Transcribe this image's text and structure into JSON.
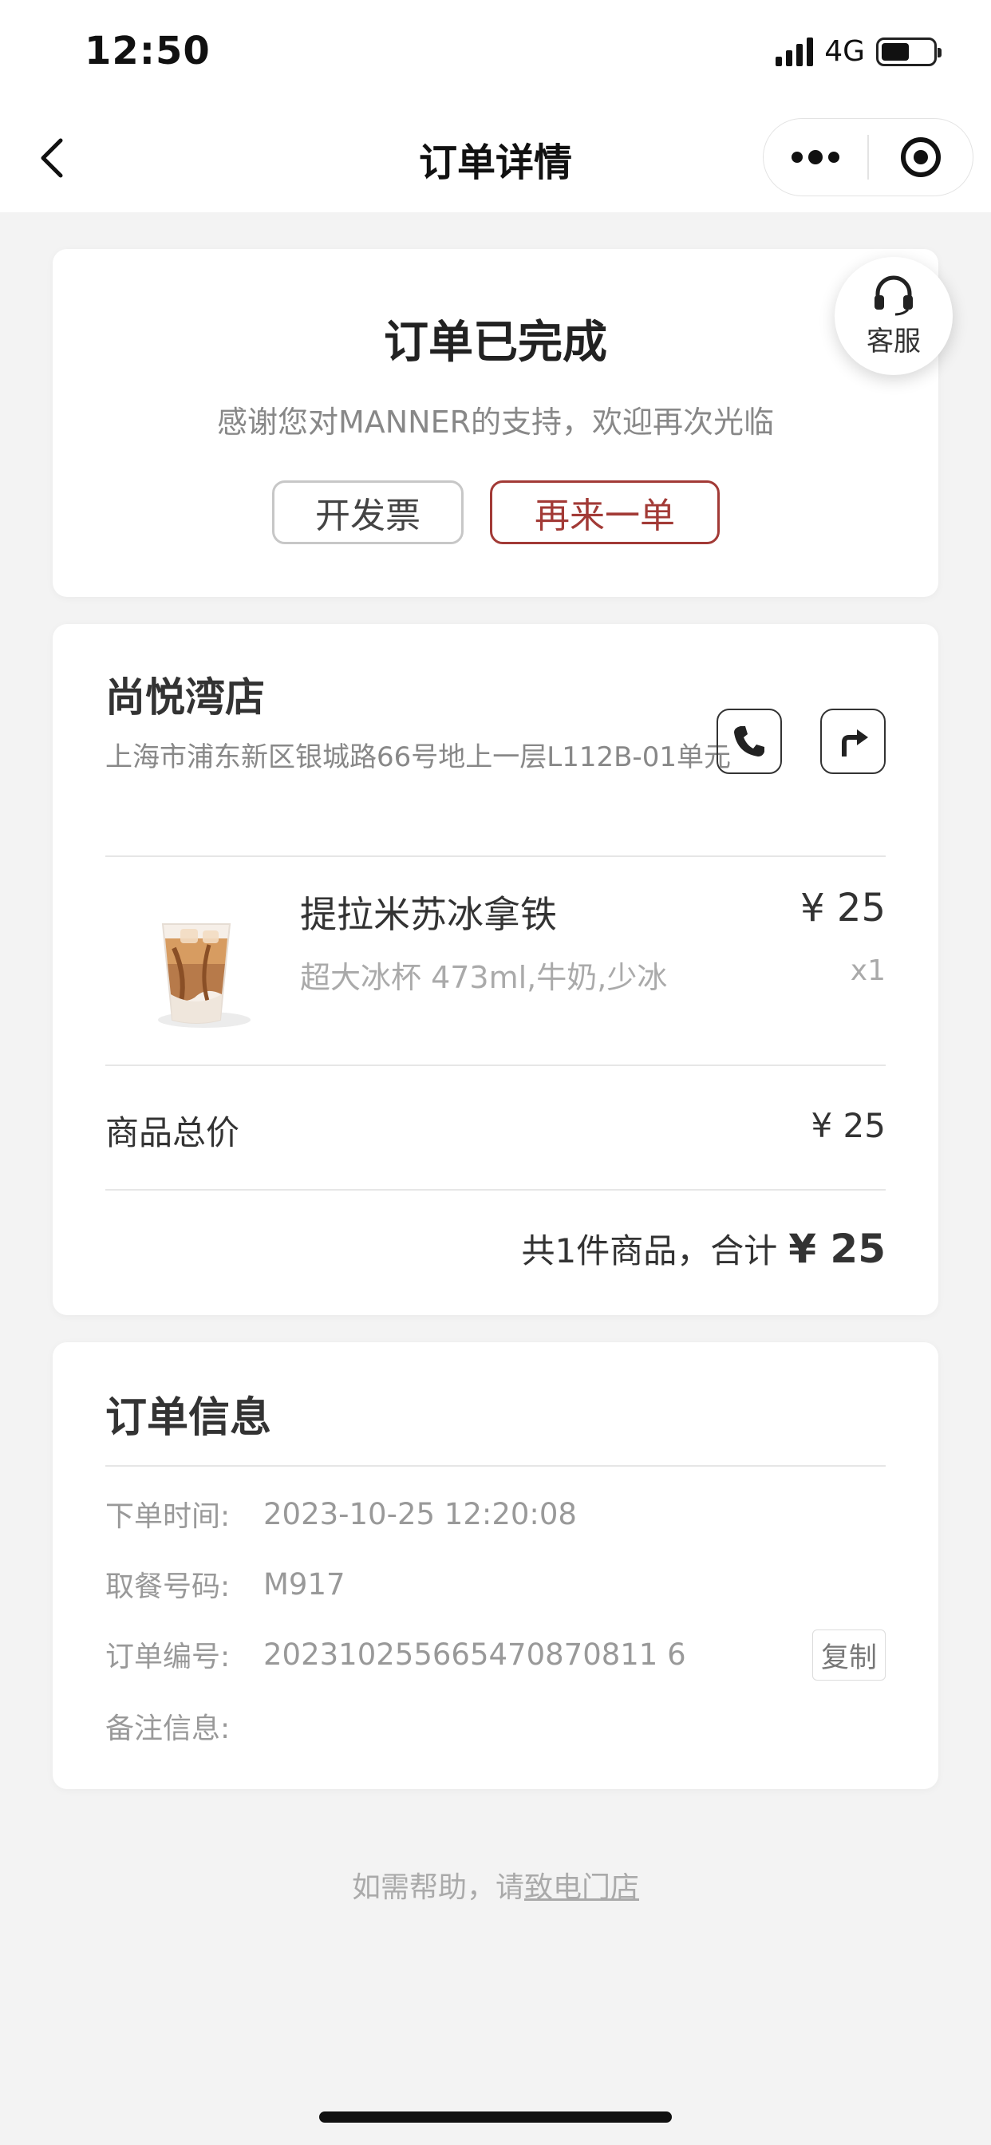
{
  "status_bar": {
    "time": "12:50",
    "network": "4G",
    "battery_level": 0.55
  },
  "nav": {
    "title": "订单详情",
    "back_icon": "chevron-left-icon",
    "more_icon": "more-dots-icon",
    "close_icon": "target-circle-icon"
  },
  "order_status": {
    "title": "订单已完成",
    "subtitle": "感谢您对MANNER的支持，欢迎再次光临",
    "invoice_button": "开发票",
    "reorder_button": "再来一单",
    "reorder_color": "#a23a36"
  },
  "service": {
    "label": "客服",
    "icon": "headset-icon"
  },
  "store": {
    "name": "尚悦湾店",
    "address": "上海市浦东新区银城路66号地上一层L112B-01单元",
    "phone_icon": "phone-icon",
    "navigate_icon": "route-arrow-icon"
  },
  "product": {
    "name": "提拉米苏冰拿铁",
    "spec": "超大冰杯 473ml,牛奶,少冰",
    "price": "¥ 25",
    "quantity": "x1",
    "image_icon": "iced-latte-cup-icon"
  },
  "totals": {
    "goods_total_label": "商品总价",
    "goods_total_value": "¥ 25",
    "summary_text": "共1件商品，合计",
    "summary_amount": "¥ 25"
  },
  "order_info": {
    "title": "订单信息",
    "rows": [
      {
        "label": "下单时间:",
        "value": "2023-10-25 12:20:08"
      },
      {
        "label": "取餐号码:",
        "value": "M917"
      },
      {
        "label": "订单编号:",
        "value": "202310255665470870811 6"
      },
      {
        "label": "备注信息:",
        "value": ""
      }
    ],
    "copy_button": "复制"
  },
  "help": {
    "prefix": "如需帮助，请",
    "link": "致电门店"
  }
}
